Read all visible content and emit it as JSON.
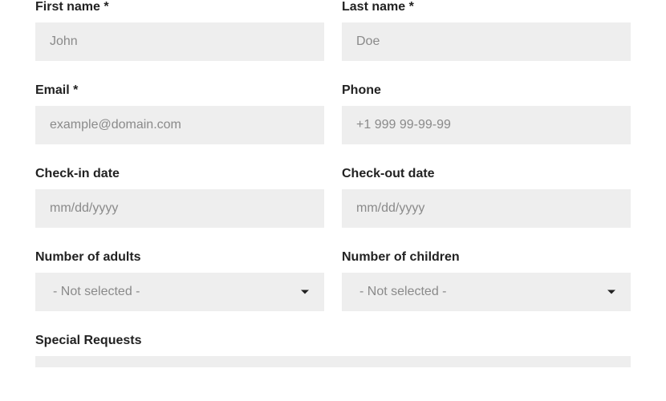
{
  "fields": {
    "first_name": {
      "label": "First name *",
      "placeholder": "John"
    },
    "last_name": {
      "label": "Last name *",
      "placeholder": "Doe"
    },
    "email": {
      "label": "Email *",
      "placeholder": "example@domain.com"
    },
    "phone": {
      "label": "Phone",
      "placeholder": "+1 999 99-99-99"
    },
    "check_in": {
      "label": "Check-in date",
      "placeholder": "mm/dd/yyyy"
    },
    "check_out": {
      "label": "Check-out date",
      "placeholder": "mm/dd/yyyy"
    },
    "adults": {
      "label": "Number of adults",
      "selected": "- Not selected -"
    },
    "children": {
      "label": "Number of children",
      "selected": "- Not selected -"
    },
    "special": {
      "label": "Special Requests"
    }
  }
}
